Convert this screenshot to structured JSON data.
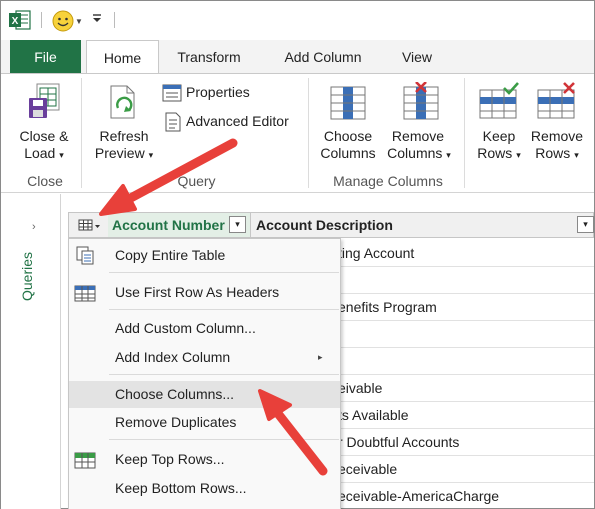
{
  "ribbon_tabs": {
    "file": "File",
    "home": "Home",
    "transform": "Transform",
    "add_column": "Add Column",
    "view": "View"
  },
  "ribbon": {
    "close_load_line1": "Close &",
    "close_load_line2": "Load",
    "refresh_line1": "Refresh",
    "refresh_line2": "Preview",
    "properties": "Properties",
    "advanced_editor": "Advanced Editor",
    "choose_cols_line1": "Choose",
    "choose_cols_line2": "Columns",
    "remove_cols_line1": "Remove",
    "remove_cols_line2": "Columns",
    "keep_rows_line1": "Keep",
    "keep_rows_line2": "Rows",
    "remove_rows_line1": "Remove",
    "remove_rows_line2": "Rows",
    "dropdown_glyph": "▾",
    "groups": {
      "close": "Close",
      "query": "Query",
      "manage_columns": "Manage Columns"
    }
  },
  "queries_pane": {
    "label": "Queries",
    "chevron": "›"
  },
  "grid": {
    "columns": [
      "Account Number",
      "Account Description"
    ],
    "dropdown_glyph": "▾",
    "rows": [
      "ting Account",
      "",
      "enefits Program",
      "",
      "eivable",
      "ts Available",
      "r Doubtful Accounts",
      "eceivable",
      "eceivable-AmericaCharge"
    ]
  },
  "context_menu": {
    "items": [
      {
        "label": "Copy Entire Table",
        "icon": "copy-table-icon"
      },
      {
        "label": "Use First Row As Headers",
        "icon": "headers-icon"
      },
      {
        "label": "Add Custom Column...",
        "icon": ""
      },
      {
        "label": "Add Index Column",
        "icon": "",
        "submenu": "▸"
      },
      {
        "label": "Choose Columns...",
        "icon": "",
        "highlighted": true
      },
      {
        "label": "Remove Duplicates",
        "icon": ""
      },
      {
        "label": "Keep Top Rows...",
        "icon": "keep-rows-icon"
      },
      {
        "label": "Keep Bottom Rows...",
        "icon": ""
      }
    ]
  },
  "colors": {
    "excel_green": "#217346",
    "arrow_red": "#e8403a"
  }
}
